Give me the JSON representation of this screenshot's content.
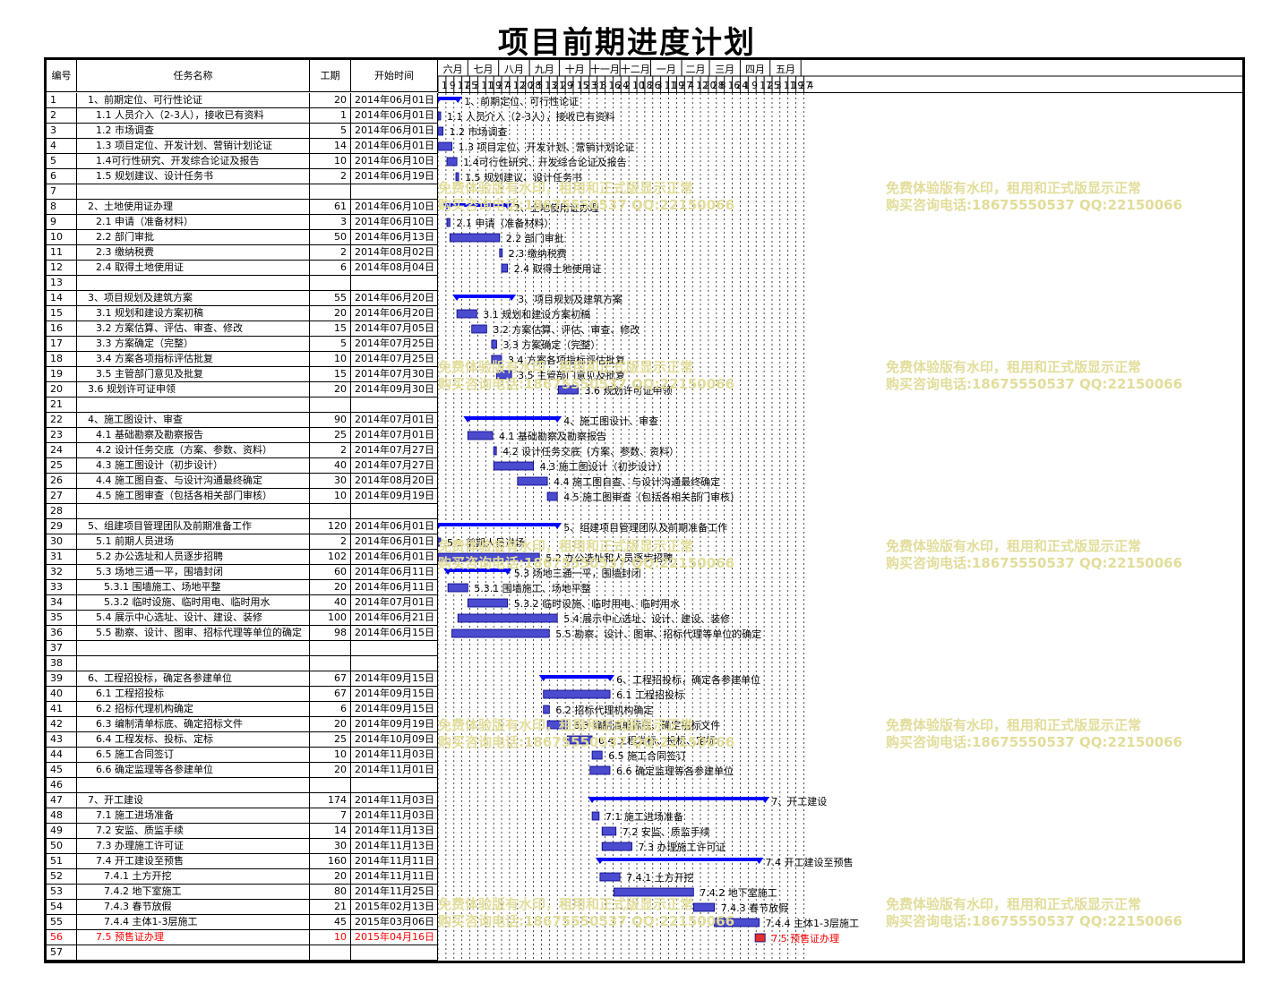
{
  "title": "项目前期进度计划",
  "headers": {
    "id": "编号",
    "name": "任务名称",
    "duration": "工期",
    "start": "开始时间"
  },
  "watermark": {
    "line1": "免费体验版有水印，租用和正式版显示正常",
    "line2": "购买咨询电话:18675550537 QQ:22150066"
  },
  "colors": {
    "summary": "#0000ff",
    "task": "#4b4bd0",
    "task_edge": "#000080",
    "highlight": "#ff0000",
    "highlight_bar": "#e03030"
  },
  "chart_data": {
    "type": "gantt",
    "timeline_start": "2014-06-01",
    "months": [
      {
        "label": "六月",
        "days": [
          "1",
          "9",
          "17",
          "25"
        ]
      },
      {
        "label": "七月",
        "days": [
          "3",
          "11",
          "19",
          "27"
        ]
      },
      {
        "label": "八月",
        "days": [
          "4",
          "12",
          "20",
          "28"
        ]
      },
      {
        "label": "九月",
        "days": [
          "5",
          "13",
          "21",
          "29"
        ]
      },
      {
        "label": "十月",
        "days": [
          "7",
          "15",
          "23",
          "31"
        ]
      },
      {
        "label": "十一月",
        "days": [
          "8",
          "16",
          "24"
        ]
      },
      {
        "label": "十二月",
        "days": [
          "2",
          "10",
          "18",
          "26"
        ]
      },
      {
        "label": "一月",
        "days": [
          "3",
          "11",
          "19",
          "27"
        ]
      },
      {
        "label": "二月",
        "days": [
          "4",
          "12",
          "20",
          "28"
        ]
      },
      {
        "label": "三月",
        "days": [
          "8",
          "16",
          "24"
        ]
      },
      {
        "label": "四月",
        "days": [
          "1",
          "9",
          "17",
          "25"
        ]
      },
      {
        "label": "五月",
        "days": [
          "3",
          "11",
          "19",
          "27"
        ]
      },
      {
        "label": "",
        "days": [
          "4"
        ]
      }
    ],
    "tasks": [
      {
        "id": "1",
        "name": "1、前期定位、可行性论证",
        "duration": 20,
        "start": "2014年06月01日",
        "kind": "summary",
        "level": 0
      },
      {
        "id": "2",
        "name": "1.1 人员介入（2-3人），接收已有资料",
        "duration": 1,
        "start": "2014年06月01日",
        "kind": "task",
        "level": 1
      },
      {
        "id": "3",
        "name": "1.2 市场调查",
        "duration": 5,
        "start": "2014年06月01日",
        "kind": "task",
        "level": 1
      },
      {
        "id": "4",
        "name": "1.3 项目定位、开发计划、营销计划论证",
        "duration": 14,
        "start": "2014年06月01日",
        "kind": "task",
        "level": 1
      },
      {
        "id": "5",
        "name": "1.4可行性研究、开发综合论证及报告",
        "duration": 10,
        "start": "2014年06月10日",
        "kind": "task",
        "level": 1
      },
      {
        "id": "6",
        "name": "1.5 规划建议、设计任务书",
        "duration": 2,
        "start": "2014年06月19日",
        "kind": "task",
        "level": 1
      },
      {
        "id": "7",
        "name": "",
        "duration": null,
        "start": "",
        "kind": "empty",
        "level": 0
      },
      {
        "id": "8",
        "name": "2、土地使用证办理",
        "duration": 61,
        "start": "2014年06月10日",
        "kind": "summary",
        "level": 0
      },
      {
        "id": "9",
        "name": "2.1 申请（准备材料）",
        "duration": 3,
        "start": "2014年06月10日",
        "kind": "task",
        "level": 1
      },
      {
        "id": "10",
        "name": "2.2 部门审批",
        "duration": 50,
        "start": "2014年06月13日",
        "kind": "task",
        "level": 1
      },
      {
        "id": "11",
        "name": "2.3 缴纳税费",
        "duration": 2,
        "start": "2014年08月02日",
        "kind": "task",
        "level": 1
      },
      {
        "id": "12",
        "name": "2.4 取得土地使用证",
        "duration": 6,
        "start": "2014年08月04日",
        "kind": "task",
        "level": 1
      },
      {
        "id": "13",
        "name": "",
        "duration": null,
        "start": "",
        "kind": "empty",
        "level": 0
      },
      {
        "id": "14",
        "name": "3、项目规划及建筑方案",
        "duration": 55,
        "start": "2014年06月20日",
        "kind": "summary",
        "level": 0
      },
      {
        "id": "15",
        "name": "3.1 规划和建设方案初稿",
        "duration": 20,
        "start": "2014年06月20日",
        "kind": "task",
        "level": 1
      },
      {
        "id": "16",
        "name": "3.2 方案估算、评估、审查、修改",
        "duration": 15,
        "start": "2014年07月05日",
        "kind": "task",
        "level": 1
      },
      {
        "id": "17",
        "name": "3.3 方案确定（完整）",
        "duration": 5,
        "start": "2014年07月25日",
        "kind": "task",
        "level": 1
      },
      {
        "id": "18",
        "name": "3.4 方案各项指标评估批复",
        "duration": 10,
        "start": "2014年07月25日",
        "kind": "task",
        "level": 1
      },
      {
        "id": "19",
        "name": "3.5 主管部门意见及批复",
        "duration": 15,
        "start": "2014年07月30日",
        "kind": "task",
        "level": 1
      },
      {
        "id": "20",
        "name": "3.6 规划许可证申领",
        "duration": 20,
        "start": "2014年09月30日",
        "kind": "task",
        "level": 0
      },
      {
        "id": "21",
        "name": "",
        "duration": null,
        "start": "",
        "kind": "empty",
        "level": 0
      },
      {
        "id": "22",
        "name": "4、施工图设计、审查",
        "duration": 90,
        "start": "2014年07月01日",
        "kind": "summary",
        "level": 0
      },
      {
        "id": "23",
        "name": "4.1 基础勘察及勘察报告",
        "duration": 25,
        "start": "2014年07月01日",
        "kind": "task",
        "level": 1
      },
      {
        "id": "24",
        "name": "4.2 设计任务交底（方案、参数、资料）",
        "duration": 2,
        "start": "2014年07月27日",
        "kind": "task",
        "level": 1
      },
      {
        "id": "25",
        "name": "4.3 施工图设计（初步设计）",
        "duration": 40,
        "start": "2014年07月27日",
        "kind": "task",
        "level": 1
      },
      {
        "id": "26",
        "name": "4.4 施工图自查、与设计沟通最终确定",
        "duration": 30,
        "start": "2014年08月20日",
        "kind": "task",
        "level": 1
      },
      {
        "id": "27",
        "name": "4.5 施工图审查（包括各相关部门审核）",
        "duration": 10,
        "start": "2014年09月19日",
        "kind": "task",
        "level": 1
      },
      {
        "id": "28",
        "name": "",
        "duration": null,
        "start": "",
        "kind": "empty",
        "level": 0
      },
      {
        "id": "29",
        "name": "5、组建项目管理团队及前期准备工作",
        "duration": 120,
        "start": "2014年06月01日",
        "kind": "summary",
        "level": 0
      },
      {
        "id": "30",
        "name": "5.1 前期人员进场",
        "duration": 2,
        "start": "2014年06月01日",
        "kind": "task",
        "level": 1
      },
      {
        "id": "31",
        "name": "5.2 办公选址和人员逐步招聘",
        "duration": 102,
        "start": "2014年06月01日",
        "kind": "task",
        "level": 1
      },
      {
        "id": "32",
        "name": "5.3 场地三通一平，围墙封闭",
        "duration": 60,
        "start": "2014年06月11日",
        "kind": "summary",
        "level": 1
      },
      {
        "id": "33",
        "name": "5.3.1 围墙施工、场地平整",
        "duration": 20,
        "start": "2014年06月11日",
        "kind": "task",
        "level": 2
      },
      {
        "id": "34",
        "name": "5.3.2 临时设施、临时用电、临时用水",
        "duration": 40,
        "start": "2014年07月01日",
        "kind": "task",
        "level": 2
      },
      {
        "id": "35",
        "name": "5.4 展示中心选址、设计、建设、装修",
        "duration": 100,
        "start": "2014年06月21日",
        "kind": "task",
        "level": 1
      },
      {
        "id": "36",
        "name": "5.5 勘察、设计、图审、招标代理等单位的确定",
        "duration": 98,
        "start": "2014年06月15日",
        "kind": "task",
        "level": 1
      },
      {
        "id": "37",
        "name": "",
        "duration": null,
        "start": "",
        "kind": "empty",
        "level": 0
      },
      {
        "id": "38",
        "name": "",
        "duration": null,
        "start": "",
        "kind": "empty",
        "level": 0
      },
      {
        "id": "39",
        "name": "6、工程招投标，确定各参建单位",
        "duration": 67,
        "start": "2014年09月15日",
        "kind": "summary",
        "level": 0
      },
      {
        "id": "40",
        "name": "6.1 工程招投标",
        "duration": 67,
        "start": "2014年09月15日",
        "kind": "task",
        "level": 1
      },
      {
        "id": "41",
        "name": "6.2 招标代理机构确定",
        "duration": 6,
        "start": "2014年09月15日",
        "kind": "task",
        "level": 1
      },
      {
        "id": "42",
        "name": "6.3 编制清单标底、确定招标文件",
        "duration": 20,
        "start": "2014年09月19日",
        "kind": "task",
        "level": 1
      },
      {
        "id": "43",
        "name": "6.4 工程发标、投标、定标",
        "duration": 25,
        "start": "2014年10月09日",
        "kind": "task",
        "level": 1
      },
      {
        "id": "44",
        "name": "6.5 施工合同签订",
        "duration": 10,
        "start": "2014年11月03日",
        "kind": "task",
        "level": 1
      },
      {
        "id": "45",
        "name": "6.6 确定监理等各参建单位",
        "duration": 20,
        "start": "2014年11月01日",
        "kind": "task",
        "level": 1
      },
      {
        "id": "46",
        "name": "",
        "duration": null,
        "start": "",
        "kind": "empty",
        "level": 0
      },
      {
        "id": "47",
        "name": "7、开工建设",
        "duration": 174,
        "start": "2014年11月03日",
        "kind": "summary",
        "level": 0
      },
      {
        "id": "48",
        "name": "7.1 施工进场准备",
        "duration": 7,
        "start": "2014年11月03日",
        "kind": "task",
        "level": 1
      },
      {
        "id": "49",
        "name": "7.2 安监、质监手续",
        "duration": 14,
        "start": "2014年11月13日",
        "kind": "task",
        "level": 1
      },
      {
        "id": "50",
        "name": "7.3 办理施工许可证",
        "duration": 30,
        "start": "2014年11月13日",
        "kind": "task",
        "level": 1
      },
      {
        "id": "51",
        "name": "7.4 开工建设至预售",
        "duration": 160,
        "start": "2014年11月11日",
        "kind": "summary",
        "level": 1
      },
      {
        "id": "52",
        "name": "7.4.1 土方开挖",
        "duration": 20,
        "start": "2014年11月11日",
        "kind": "task",
        "level": 2
      },
      {
        "id": "53",
        "name": "7.4.2 地下室施工",
        "duration": 80,
        "start": "2014年11月25日",
        "kind": "task",
        "level": 2
      },
      {
        "id": "54",
        "name": "7.4.3 春节放假",
        "duration": 21,
        "start": "2015年02月13日",
        "kind": "task",
        "level": 2
      },
      {
        "id": "55",
        "name": "7.4.4 主体1-3层施工",
        "duration": 45,
        "start": "2015年03月06日",
        "kind": "task",
        "level": 2
      },
      {
        "id": "56",
        "name": "7.5 预售证办理",
        "duration": 10,
        "start": "2015年04月16日",
        "kind": "highlight",
        "level": 1
      },
      {
        "id": "57",
        "name": "",
        "duration": null,
        "start": "",
        "kind": "empty",
        "level": 0
      }
    ]
  }
}
